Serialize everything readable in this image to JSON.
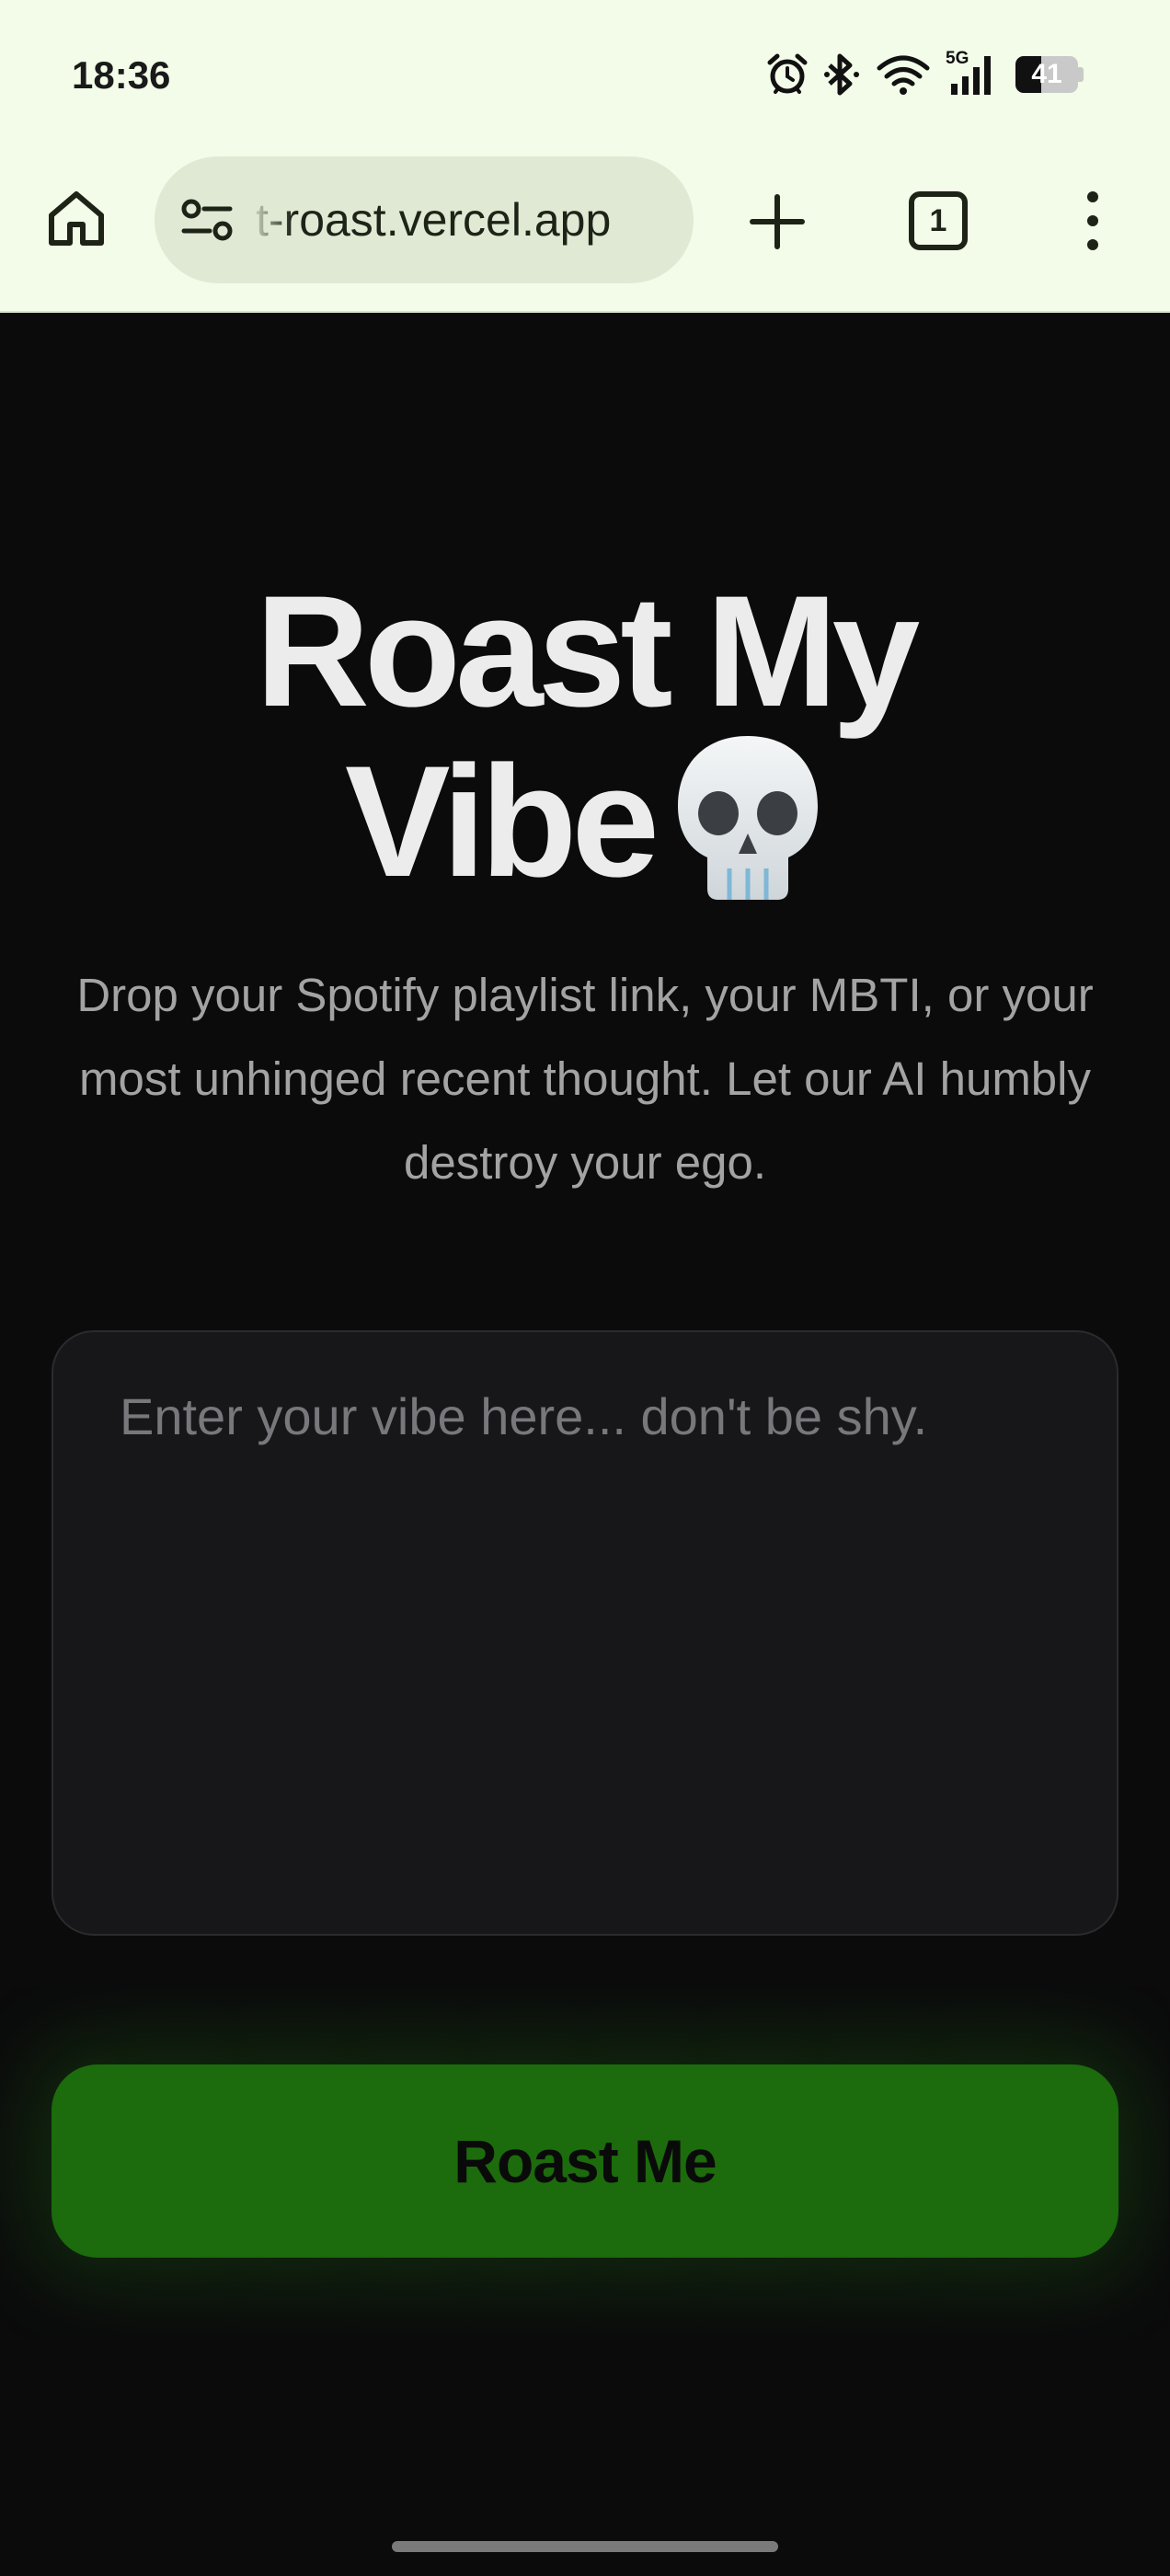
{
  "status_bar": {
    "time": "18:36",
    "network_label": "5G",
    "battery_level": "41",
    "battery_fraction": 0.41,
    "icons": [
      "alarm-icon",
      "bluetooth-icon",
      "wifi-icon",
      "cellular-signal-icon",
      "battery-icon"
    ]
  },
  "browser": {
    "url": "t-roast.vercel.app",
    "tab_count": "1",
    "icons": [
      "home-icon",
      "site-settings-icon",
      "plus-icon",
      "tabs-icon",
      "more-vert-icon"
    ]
  },
  "hero": {
    "title_line1": "Roast My",
    "title_line2": "Vibe",
    "title_emoji": "skull-icon",
    "subtitle": "Drop your Spotify playlist link, your MBTI, or your most unhinged recent thought. Let our AI humbly destroy your ego."
  },
  "form": {
    "input_value": "",
    "input_placeholder": "Enter your vibe here... don't be shy.",
    "submit_label": "Roast Me"
  },
  "colors": {
    "page_background": "#0b0b0c",
    "browser_chrome": "#f2fce8",
    "accent_green": "#1c6b0c",
    "title_text": "#ececec",
    "muted_text": "#a3a3a3"
  }
}
